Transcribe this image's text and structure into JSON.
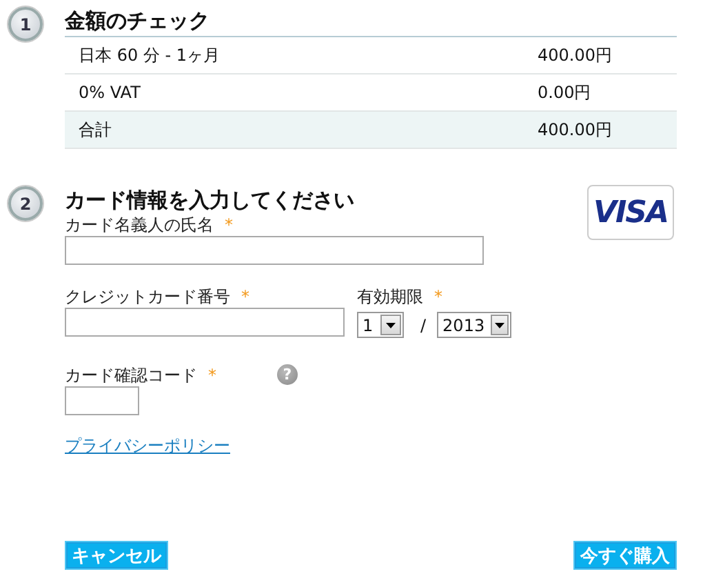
{
  "steps": [
    {
      "number": "1",
      "title": "金額のチェック"
    },
    {
      "number": "2",
      "title": "カード情報を入力してください"
    }
  ],
  "summary": {
    "rows": [
      {
        "item": "日本 60 分 - 1ヶ月",
        "amount": "400.00円",
        "kind": "line"
      },
      {
        "item": "0% VAT",
        "amount": "0.00円",
        "kind": "line"
      },
      {
        "item": "合計",
        "amount": "400.00円",
        "kind": "total"
      }
    ]
  },
  "card_logo": "VISA",
  "fields": {
    "name": {
      "label": "カード名義人の氏名",
      "marker": "*"
    },
    "number": {
      "label": "クレジットカード番号",
      "marker": "*"
    },
    "expiry": {
      "label": "有効期限",
      "marker": "*",
      "month": "1",
      "separator": "/",
      "year": "2013"
    },
    "cvc": {
      "label": "カード確認コード",
      "marker": "*",
      "help": "?"
    }
  },
  "privacy_link": "プライバシーポリシー",
  "buttons": {
    "cancel": "キャンセル",
    "buy": "今すぐ購入"
  }
}
